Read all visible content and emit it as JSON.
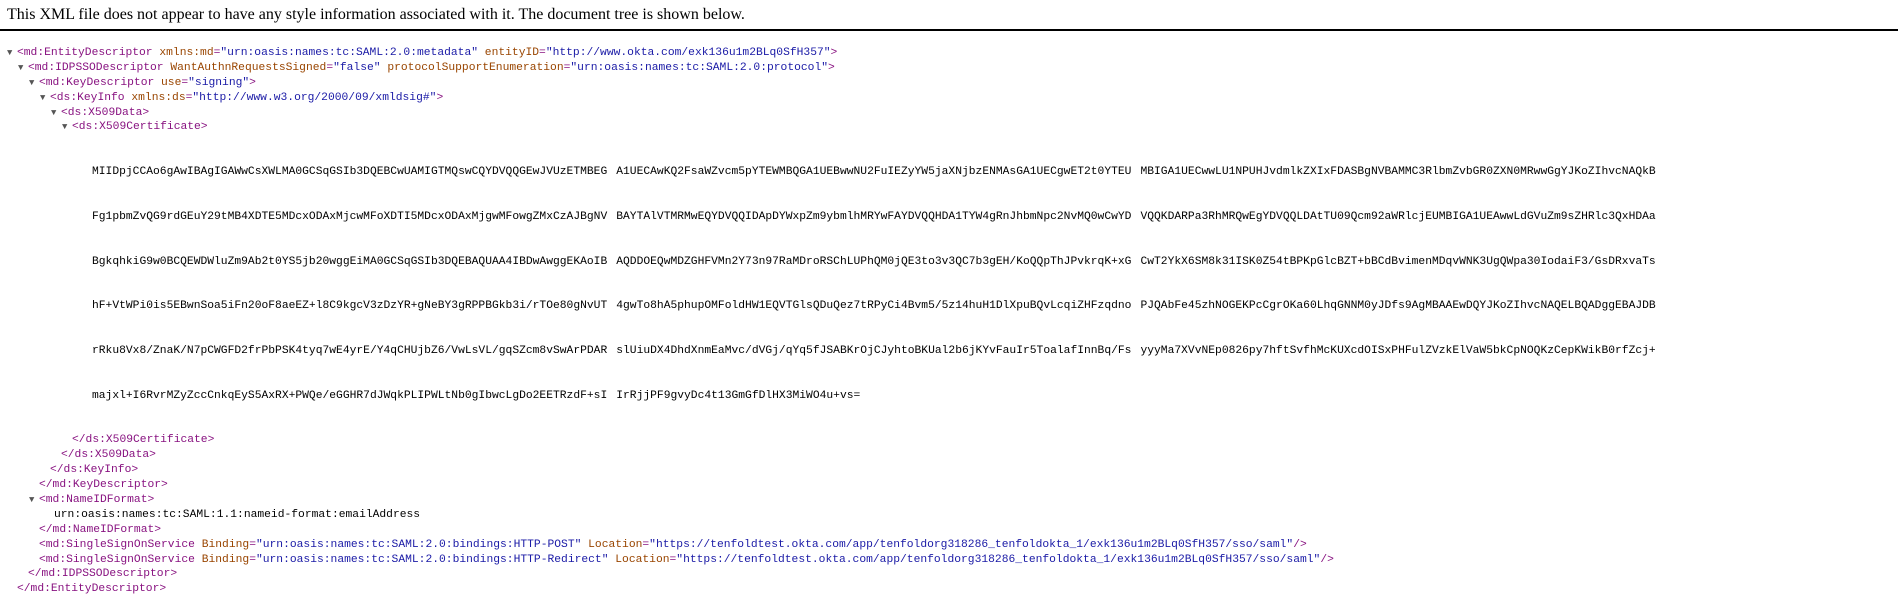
{
  "notice": "This XML file does not appear to have any style information associated with it. The document tree is shown below.",
  "toggles": {
    "expanded": "▼"
  },
  "tree": {
    "entity_descriptor_open": "<md:EntityDescriptor",
    "entity_ns_attr": "xmlns:md",
    "entity_ns_val": "\"urn:oasis:names:tc:SAML:2.0:metadata\"",
    "entity_id_attr": "entityID",
    "entity_id_val": "\"http://www.okta.com/exk136u1m2BLq0SfH357\"",
    "idp_open": "<md:IDPSSODescriptor",
    "idp_attr1": "WantAuthnRequestsSigned",
    "idp_val1": "\"false\"",
    "idp_attr2": "protocolSupportEnumeration",
    "idp_val2": "\"urn:oasis:names:tc:SAML:2.0:protocol\"",
    "keydesc_open": "<md:KeyDescriptor",
    "keydesc_attr": "use",
    "keydesc_val": "\"signing\"",
    "keyinfo_open": "<ds:KeyInfo",
    "keyinfo_attr": "xmlns:ds",
    "keyinfo_val": "\"http://www.w3.org/2000/09/xmldsig#\"",
    "x509data_open": "<ds:X509Data>",
    "x509cert_open": "<ds:X509Certificate>",
    "cert_col1": [
      "MIIDpjCCAo6gAwIBAgIGAWwCsXWLMA0GCSqGSIb3DQEBCwUAMIGTMQswCQYDVQQGEwJVUzETMBEG",
      "Fg1pbmZvQG9rdGEuY29tMB4XDTE5MDcxODAxMjcwMFoXDTI5MDcxODAxMjgwMFowgZMxCzAJBgNV",
      "BgkqhkiG9w0BCQEWDWluZm9Ab2t0YS5jb20wggEiMA0GCSqGSIb3DQEBAQUAA4IBDwAwggEKAoIB",
      "hF+VtWPi0is5EBwnSoa5iFn20oF8aeEZ+l8C9kgcV3zDzYR+gNeBY3gRPPBGkb3i/rTOe80gNvUT",
      "rRku8Vx8/ZnaK/N7pCWGFD2frPbPSK4tyq7wE4yrE/Y4qCHUjbZ6/VwLsVL/gqSZcm8vSwArPDAR",
      "majxl+I6RvrMZyZccCnkqEyS5AxRX+PWQe/eGGHR7dJWqkPLIPWLtNb0gIbwcLgDo2EETRzdF+sI"
    ],
    "cert_col2": [
      "A1UECAwKQ2FsaWZvcm5pYTEWMBQGA1UEBwwNU2FuIEZyYW5jaXNjbzENMAsGA1UECgwET2t0YTEU",
      "BAYTAlVTMRMwEQYDVQQIDApDYWxpZm9ybmlhMRYwFAYDVQQHDA1TYW4gRnJhbmNpc2NvMQ0wCwYD",
      "AQDDOEQwMDZGHFVMn2Y73n97RaMDroRSChLUPhQM0jQE3to3v3QC7b3gEH/KoQQpThJPvkrqK+xG",
      "4gwTo8hA5phupOMFoldHW1EQVTGlsQDuQez7tRPyCi4Bvm5/5z14huH1DlXpuBQvLcqiZHFzqdno",
      "slUiuDX4DhdXnmEaMvc/dVGj/qYq5fJSABKrOjCJyhtoBKUal2b6jKYvFauIr5ToalafInnBq/Fs",
      "IrRjjPF9gvyDc4t13GmGfDlHX3MiWO4u+vs="
    ],
    "cert_col3": [
      "MBIGA1UECwwLU1NPUHJvdmlkZXIxFDASBgNVBAMMC3RlbmZvbGR0ZXN0MRwwGgYJKoZIhvcNAQkB",
      "VQQKDARPa3RhMRQwEgYDVQQLDAtTU09Qcm92aWRlcjEUMBIGA1UEAwwLdGVuZm9sZHRlc3QxHDAa",
      "CwT2YkX6SM8k31ISK0Z54tBPKpGlcBZT+bBCdBvimenMDqvWNK3UgQWpa30IodaiF3/GsDRxvaTs",
      "PJQAbFe45zhNOGEKPcCgrOKa60LhqGNNM0yJDfs9AgMBAAEwDQYJKoZIhvcNAQELBQADggEBAJDB",
      "yyyMa7XVvNEp0826py7hftSvfhMcKUXcdOISxPHFulZVzkElVaW5bkCpNOQKzCepKWikB0rfZcj+",
      ""
    ],
    "x509cert_close": "</ds:X509Certificate>",
    "x509data_close": "</ds:X509Data>",
    "keyinfo_close": "</ds:KeyInfo>",
    "keydesc_close": "</md:KeyDescriptor>",
    "nameid_open": "<md:NameIDFormat>",
    "nameid_text": "urn:oasis:names:tc:SAML:1.1:nameid-format:emailAddress",
    "nameid_close": "</md:NameIDFormat>",
    "sso_open": "<md:SingleSignOnService",
    "binding_attr": "Binding",
    "location_attr": "Location",
    "sso1_binding": "\"urn:oasis:names:tc:SAML:2.0:bindings:HTTP-POST\"",
    "sso1_location": "\"https://tenfoldtest.okta.com/app/tenfoldorg318286_tenfoldokta_1/exk136u1m2BLq0SfH357/sso/saml\"",
    "sso2_binding": "\"urn:oasis:names:tc:SAML:2.0:bindings:HTTP-Redirect\"",
    "sso2_location": "\"https://tenfoldtest.okta.com/app/tenfoldorg318286_tenfoldokta_1/exk136u1m2BLq0SfH357/sso/saml\"",
    "self_close": "/>",
    "gt": ">",
    "eq": "=",
    "idp_close": "</md:IDPSSODescriptor>",
    "entity_close": "</md:EntityDescriptor>"
  }
}
